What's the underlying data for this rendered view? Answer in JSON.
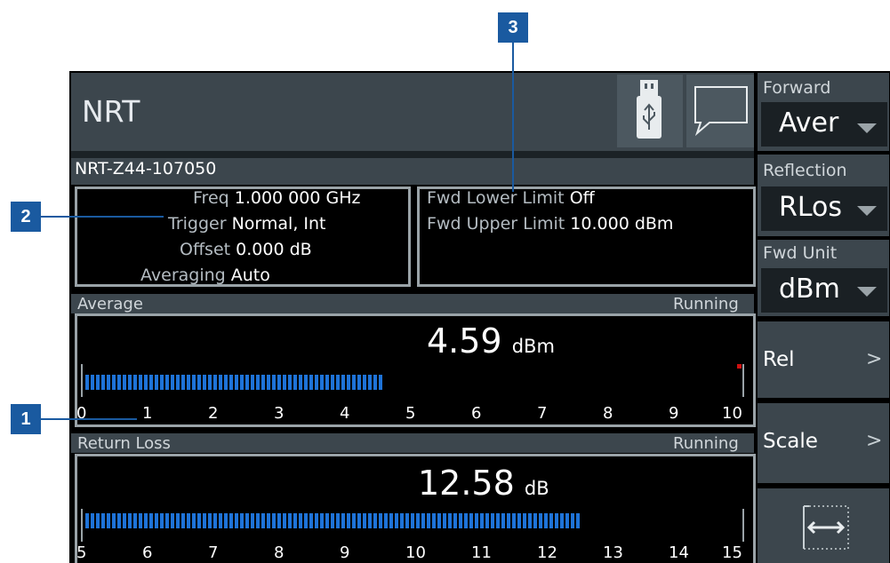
{
  "header": {
    "title": "NRT",
    "usb_icon": "usb-icon",
    "message_icon": "message-icon"
  },
  "device": {
    "id": "NRT-Z44-107050"
  },
  "settings": {
    "rows": [
      {
        "key": "Freq",
        "value": "1.000 000 GHz"
      },
      {
        "key": "Trigger",
        "value": "Normal, Int"
      },
      {
        "key": "Offset",
        "value": "0.000 dB"
      },
      {
        "key": "Averaging",
        "value": "Auto"
      }
    ]
  },
  "limits": {
    "rows": [
      {
        "key": "Fwd Lower Limit",
        "value": "Off"
      },
      {
        "key": "Fwd Upper Limit",
        "value": "10.000 dBm"
      }
    ]
  },
  "average": {
    "title": "Average",
    "status": "Running",
    "value": "4.59",
    "unit": "dBm",
    "ticks": [
      "0",
      "1",
      "2",
      "3",
      "4",
      "5",
      "6",
      "7",
      "8",
      "9",
      "10"
    ],
    "scale_min": 0,
    "scale_max": 10,
    "bar_value": 4.59,
    "marker_color": "#d01010"
  },
  "return_loss": {
    "title": "Return Loss",
    "status": "Running",
    "value": "12.58",
    "unit": "dB",
    "ticks": [
      "5",
      "6",
      "7",
      "8",
      "9",
      "10",
      "11",
      "12",
      "13",
      "14",
      "15"
    ],
    "scale_min": 5,
    "scale_max": 15,
    "bar_value": 12.58
  },
  "sidebar": {
    "forward_label": "Forward",
    "forward_value": "Aver",
    "reflection_label": "Reflection",
    "reflection_value": "RLos",
    "fwd_unit_label": "Fwd Unit",
    "fwd_unit_value": "dBm",
    "rel_label": "Rel",
    "scale_label": "Scale",
    "chevron": ">",
    "expand_icon": "horizontal-expand-icon"
  },
  "callouts": [
    "1",
    "2",
    "3"
  ],
  "colors": {
    "bar": "#1e73d8",
    "panel": "#3c464d",
    "background": "#000000",
    "callout": "#1a5aa0"
  }
}
